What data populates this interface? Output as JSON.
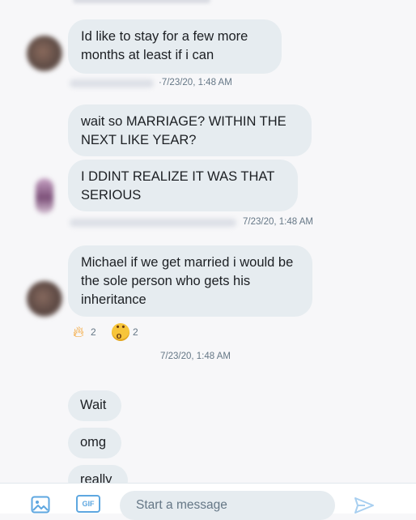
{
  "conversation": {
    "messages": [
      {
        "text": "Id like to stay for a few more months at least if i can"
      },
      {
        "text": "wait so MARRIAGE? WITHIN THE NEXT LIKE YEAR?"
      },
      {
        "text": "I DDINT REALIZE IT WAS THAT SERIOUS"
      },
      {
        "text": "Michael if we get married i would be the sole person who gets his inheritance"
      },
      {
        "text": "Wait"
      },
      {
        "text": "omg"
      },
      {
        "text": "really"
      }
    ],
    "timestamps": [
      "·7/23/20, 1:48 AM",
      "7/23/20, 1:48 AM",
      "7/23/20, 1:48 AM"
    ],
    "reactions": [
      {
        "icon": "fire-emoji",
        "count": "2"
      },
      {
        "icon": "astonished-emoji",
        "count": "2"
      }
    ]
  },
  "composer": {
    "placeholder": "Start a message",
    "gif_label": "GIF",
    "icons": [
      "image-icon",
      "gif-icon",
      "send-icon"
    ]
  },
  "colors": {
    "bubble": "#e6ecf0",
    "background": "#f7f7f9",
    "accent": "#1da1f2",
    "meta_text": "#657786"
  }
}
